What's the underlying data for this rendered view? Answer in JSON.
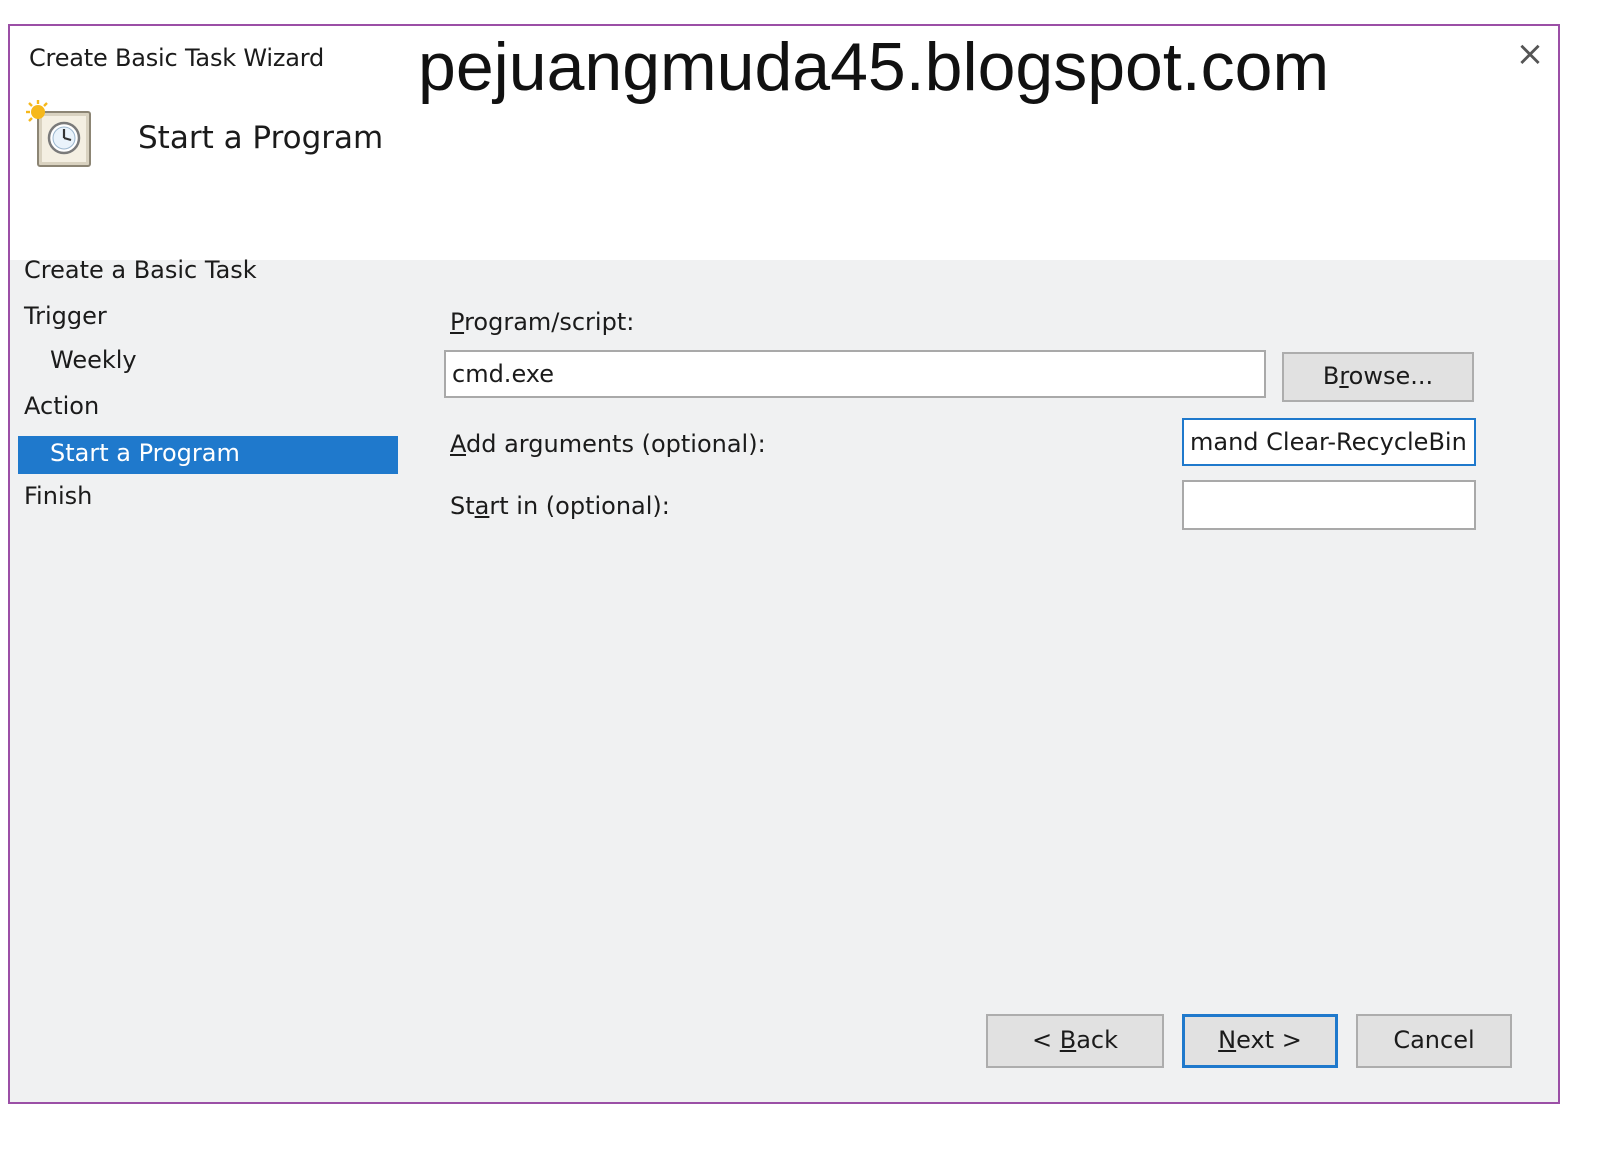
{
  "window": {
    "title": "Create Basic Task Wizard",
    "watermark": "pejuangmuda45.blogspot.com",
    "close_glyph": "×",
    "heading": "Start a Program",
    "icon": "task-scheduler-clock-icon"
  },
  "nav": {
    "section_title": "Create a Basic Task",
    "trigger": "Trigger",
    "weekly": "Weekly",
    "action": "Action",
    "start_program": "Start a Program",
    "finish": "Finish",
    "selected_color": "#1f79cc"
  },
  "form": {
    "program_label_accel": "P",
    "program_label_rest": "rogram/script:",
    "program_value": "cmd.exe",
    "browse_accel_pre": "B",
    "browse_accel": "r",
    "browse_rest": "owse...",
    "args_label_accel": "A",
    "args_label_rest": "dd arguments (optional):",
    "args_value": "mand Clear-RecycleBin\"",
    "startin_label_pre": "St",
    "startin_label_accel": "a",
    "startin_label_rest": "rt in (optional):",
    "startin_value": ""
  },
  "footer": {
    "back_pre": "< ",
    "back_accel": "B",
    "back_rest": "ack",
    "next_accel": "N",
    "next_rest": "ext >",
    "cancel": "Cancel"
  }
}
